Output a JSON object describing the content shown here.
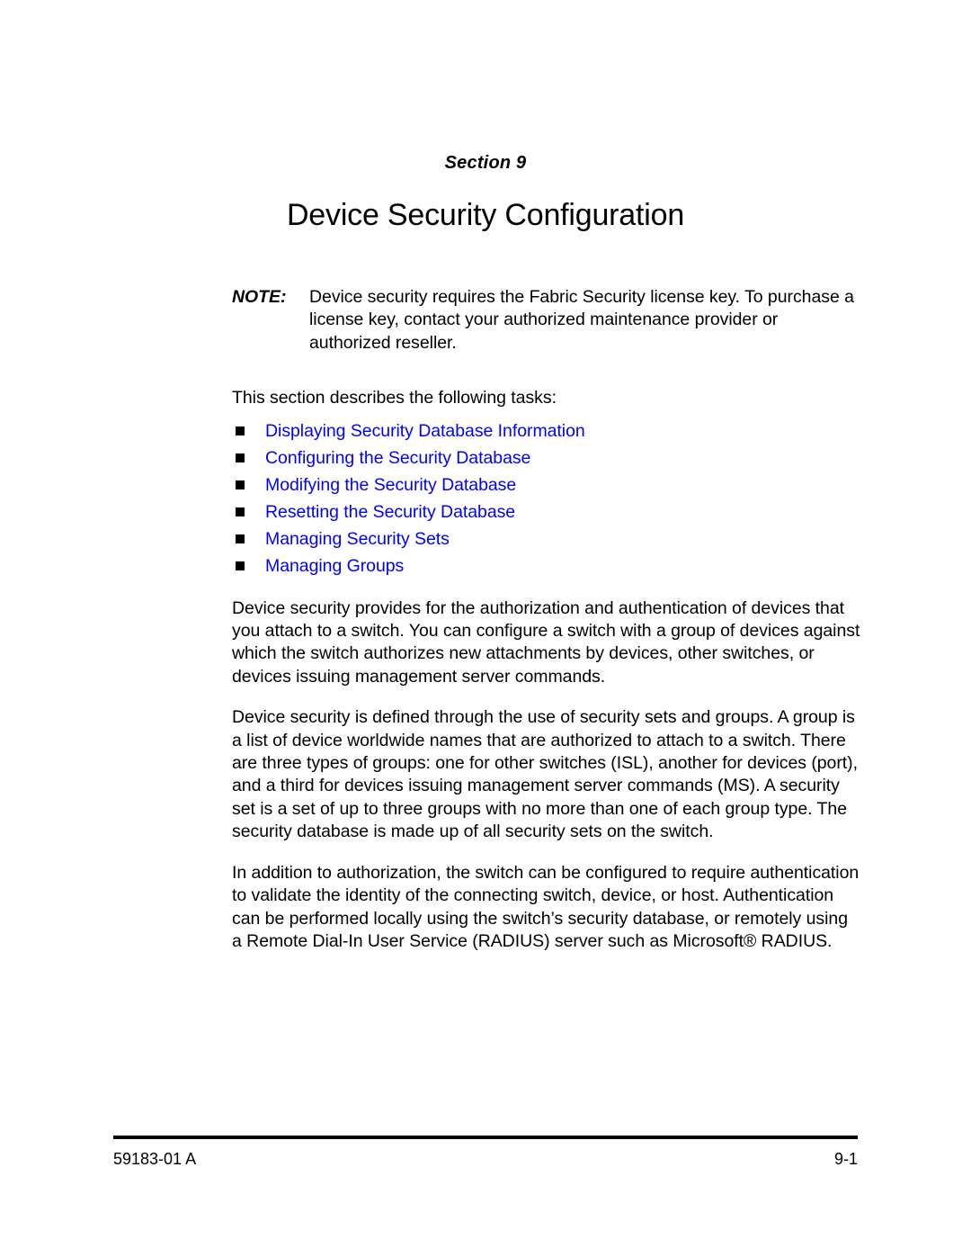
{
  "document": {
    "section_label": "Section 9",
    "title": "Device Security Configuration"
  },
  "note": {
    "label": "NOTE:",
    "text": "Device security requires the Fabric Security license key. To purchase a license key, contact your authorized maintenance provider or authorized reseller."
  },
  "tasks": {
    "intro": "This section describes the following tasks:",
    "link_color": "#0000ff",
    "bullet_color": "#000000",
    "items": [
      {
        "label": "Displaying Security Database Information"
      },
      {
        "label": "Configuring the Security Database"
      },
      {
        "label": "Modifying the Security Database"
      },
      {
        "label": "Resetting the Security Database"
      },
      {
        "label": "Managing Security Sets"
      },
      {
        "label": "Managing Groups"
      }
    ]
  },
  "paragraphs": [
    "Device security provides for the authorization and authentication of devices that you attach to a switch. You can configure a switch with a group of devices against which the switch authorizes new attachments by devices, other switches, or devices issuing management server commands.",
    "Device security is defined through the use of security sets and groups. A group is a list of device worldwide names that are authorized to attach to a switch. There are three types of groups: one for other switches (ISL), another for devices (port), and a third for devices issuing management server commands (MS). A security set is a set of up to three groups with no more than one of each group type. The security database is made up of all security sets on the switch.",
    "In addition to authorization, the switch can be configured to require authentication to validate the identity of the connecting switch, device, or host. Authentication can be performed locally using the switch’s security database, or remotely using a Remote Dial-In User Service (RADIUS) server such as Microsoft® RADIUS."
  ],
  "footer": {
    "document_number": "59183-01 A",
    "page_number": "9-1"
  }
}
